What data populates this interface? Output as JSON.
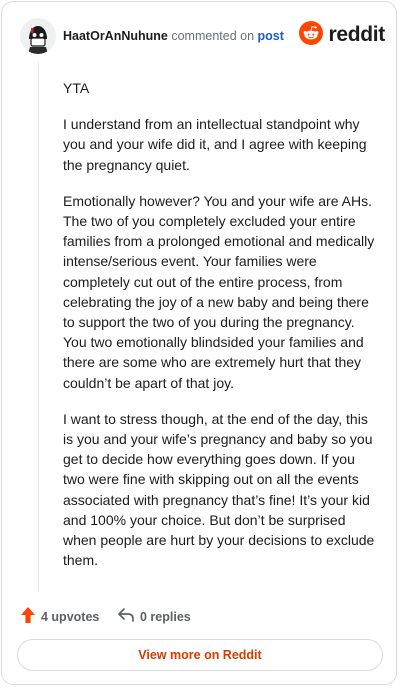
{
  "header": {
    "username": "HaatOrAnNuhune",
    "action": "commented on",
    "target": "post",
    "brand_name": "reddit",
    "avatar_icon": "avatar-icon",
    "brand_icon": "reddit-logo-icon"
  },
  "comment": {
    "paragraphs": [
      "YTA",
      "I understand from an intellectual standpoint why you and your wife did it, and I agree with keeping the pregnancy quiet.",
      "Emotionally however? You and your wife are AHs. The two of you completely excluded your entire families from a prolonged emotional and medically intense/serious event. Your families were completely cut out of the entire process, from celebrating the joy of a new baby and being there to support the two of you during the pregnancy. You two emotionally blindsided your families and there are some who are extremely hurt that they couldn’t be apart of that joy.",
      "I want to stress though, at the end of the day, this is you and your wife’s pregnancy and baby so you get to decide how everything goes down. If you two were fine with skipping out on all the events associated with pregnancy that’s fine! It’s your kid and 100% your choice. But don’t be surprised when people are hurt by your decisions to exclude them."
    ]
  },
  "footer": {
    "upvotes_label": "4 upvotes",
    "replies_label": "0 replies",
    "upvote_icon": "upvote-arrow-icon",
    "reply_icon": "reply-arrow-icon",
    "view_more_label": "View more on Reddit"
  },
  "colors": {
    "accent": "#d93a00",
    "brand": "#ff4500",
    "link": "#1c5fb8",
    "muted": "#6b7075",
    "border": "#d9dcdf"
  }
}
